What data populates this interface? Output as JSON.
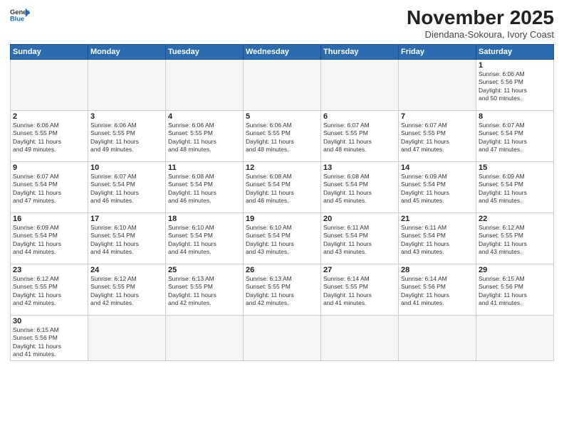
{
  "header": {
    "logo_general": "General",
    "logo_blue": "Blue",
    "month_title": "November 2025",
    "subtitle": "Diendana-Sokoura, Ivory Coast"
  },
  "days_of_week": [
    "Sunday",
    "Monday",
    "Tuesday",
    "Wednesday",
    "Thursday",
    "Friday",
    "Saturday"
  ],
  "weeks": [
    [
      {
        "day": "",
        "info": ""
      },
      {
        "day": "",
        "info": ""
      },
      {
        "day": "",
        "info": ""
      },
      {
        "day": "",
        "info": ""
      },
      {
        "day": "",
        "info": ""
      },
      {
        "day": "",
        "info": ""
      },
      {
        "day": "1",
        "info": "Sunrise: 6:06 AM\nSunset: 5:56 PM\nDaylight: 11 hours\nand 50 minutes."
      }
    ],
    [
      {
        "day": "2",
        "info": "Sunrise: 6:06 AM\nSunset: 5:55 PM\nDaylight: 11 hours\nand 49 minutes."
      },
      {
        "day": "3",
        "info": "Sunrise: 6:06 AM\nSunset: 5:55 PM\nDaylight: 11 hours\nand 49 minutes."
      },
      {
        "day": "4",
        "info": "Sunrise: 6:06 AM\nSunset: 5:55 PM\nDaylight: 11 hours\nand 48 minutes."
      },
      {
        "day": "5",
        "info": "Sunrise: 6:06 AM\nSunset: 5:55 PM\nDaylight: 11 hours\nand 48 minutes."
      },
      {
        "day": "6",
        "info": "Sunrise: 6:07 AM\nSunset: 5:55 PM\nDaylight: 11 hours\nand 48 minutes."
      },
      {
        "day": "7",
        "info": "Sunrise: 6:07 AM\nSunset: 5:55 PM\nDaylight: 11 hours\nand 47 minutes."
      },
      {
        "day": "8",
        "info": "Sunrise: 6:07 AM\nSunset: 5:54 PM\nDaylight: 11 hours\nand 47 minutes."
      }
    ],
    [
      {
        "day": "9",
        "info": "Sunrise: 6:07 AM\nSunset: 5:54 PM\nDaylight: 11 hours\nand 47 minutes."
      },
      {
        "day": "10",
        "info": "Sunrise: 6:07 AM\nSunset: 5:54 PM\nDaylight: 11 hours\nand 46 minutes."
      },
      {
        "day": "11",
        "info": "Sunrise: 6:08 AM\nSunset: 5:54 PM\nDaylight: 11 hours\nand 46 minutes."
      },
      {
        "day": "12",
        "info": "Sunrise: 6:08 AM\nSunset: 5:54 PM\nDaylight: 11 hours\nand 46 minutes."
      },
      {
        "day": "13",
        "info": "Sunrise: 6:08 AM\nSunset: 5:54 PM\nDaylight: 11 hours\nand 45 minutes."
      },
      {
        "day": "14",
        "info": "Sunrise: 6:09 AM\nSunset: 5:54 PM\nDaylight: 11 hours\nand 45 minutes."
      },
      {
        "day": "15",
        "info": "Sunrise: 6:09 AM\nSunset: 5:54 PM\nDaylight: 11 hours\nand 45 minutes."
      }
    ],
    [
      {
        "day": "16",
        "info": "Sunrise: 6:09 AM\nSunset: 5:54 PM\nDaylight: 11 hours\nand 44 minutes."
      },
      {
        "day": "17",
        "info": "Sunrise: 6:10 AM\nSunset: 5:54 PM\nDaylight: 11 hours\nand 44 minutes."
      },
      {
        "day": "18",
        "info": "Sunrise: 6:10 AM\nSunset: 5:54 PM\nDaylight: 11 hours\nand 44 minutes."
      },
      {
        "day": "19",
        "info": "Sunrise: 6:10 AM\nSunset: 5:54 PM\nDaylight: 11 hours\nand 43 minutes."
      },
      {
        "day": "20",
        "info": "Sunrise: 6:11 AM\nSunset: 5:54 PM\nDaylight: 11 hours\nand 43 minutes."
      },
      {
        "day": "21",
        "info": "Sunrise: 6:11 AM\nSunset: 5:54 PM\nDaylight: 11 hours\nand 43 minutes."
      },
      {
        "day": "22",
        "info": "Sunrise: 6:12 AM\nSunset: 5:55 PM\nDaylight: 11 hours\nand 43 minutes."
      }
    ],
    [
      {
        "day": "23",
        "info": "Sunrise: 6:12 AM\nSunset: 5:55 PM\nDaylight: 11 hours\nand 42 minutes."
      },
      {
        "day": "24",
        "info": "Sunrise: 6:12 AM\nSunset: 5:55 PM\nDaylight: 11 hours\nand 42 minutes."
      },
      {
        "day": "25",
        "info": "Sunrise: 6:13 AM\nSunset: 5:55 PM\nDaylight: 11 hours\nand 42 minutes."
      },
      {
        "day": "26",
        "info": "Sunrise: 6:13 AM\nSunset: 5:55 PM\nDaylight: 11 hours\nand 42 minutes."
      },
      {
        "day": "27",
        "info": "Sunrise: 6:14 AM\nSunset: 5:55 PM\nDaylight: 11 hours\nand 41 minutes."
      },
      {
        "day": "28",
        "info": "Sunrise: 6:14 AM\nSunset: 5:56 PM\nDaylight: 11 hours\nand 41 minutes."
      },
      {
        "day": "29",
        "info": "Sunrise: 6:15 AM\nSunset: 5:56 PM\nDaylight: 11 hours\nand 41 minutes."
      }
    ],
    [
      {
        "day": "30",
        "info": "Sunrise: 6:15 AM\nSunset: 5:56 PM\nDaylight: 11 hours\nand 41 minutes."
      },
      {
        "day": "",
        "info": ""
      },
      {
        "day": "",
        "info": ""
      },
      {
        "day": "",
        "info": ""
      },
      {
        "day": "",
        "info": ""
      },
      {
        "day": "",
        "info": ""
      },
      {
        "day": "",
        "info": ""
      }
    ]
  ]
}
